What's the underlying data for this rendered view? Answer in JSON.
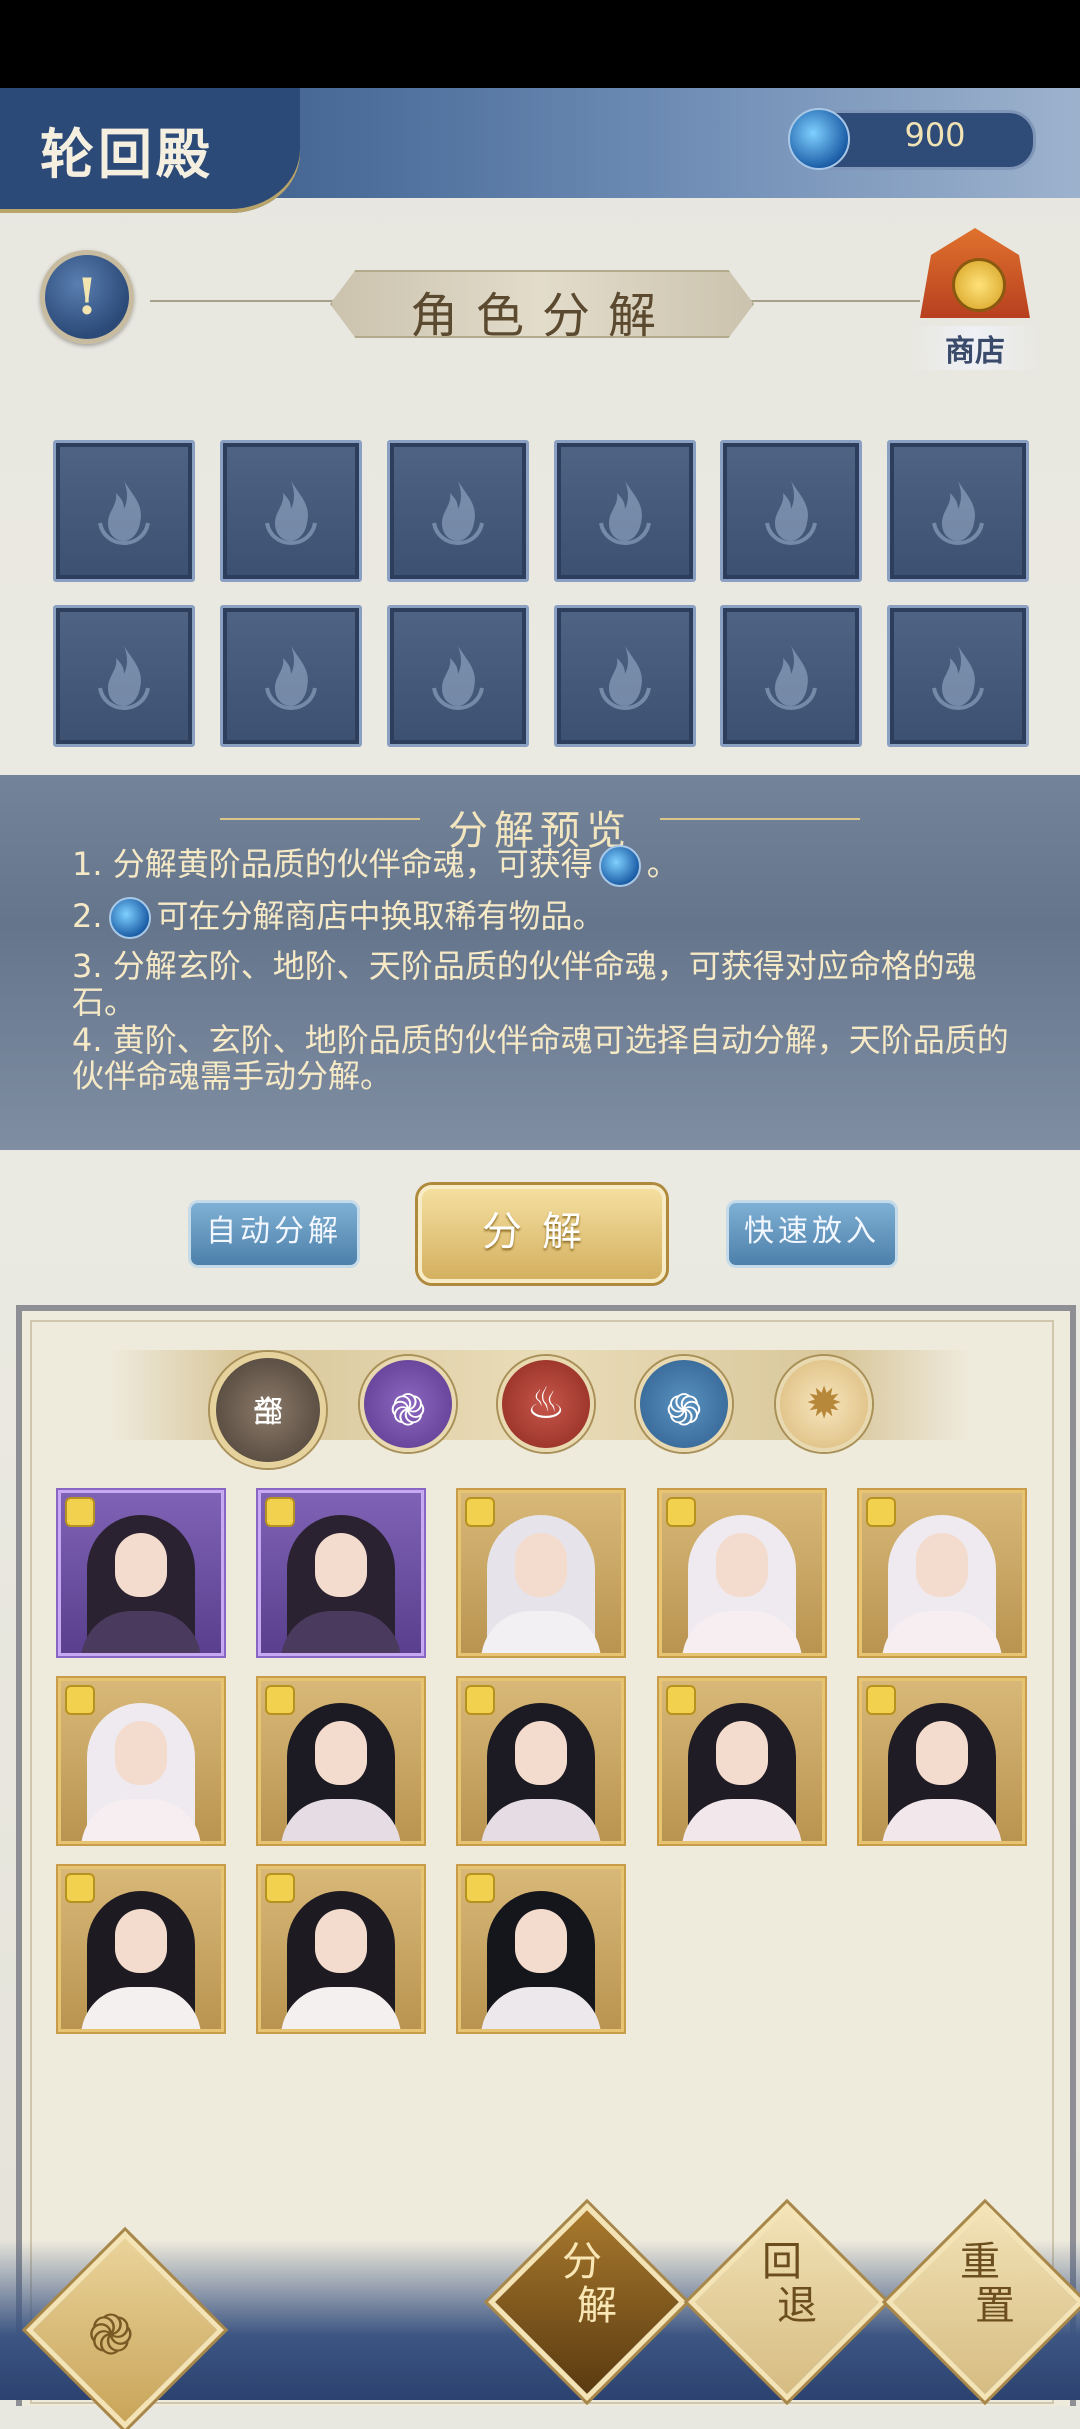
{
  "header": {
    "title": "轮回殿",
    "currency_value": "900"
  },
  "section_title": "角色分解",
  "shop_label": "商店",
  "slots_count": 12,
  "preview": {
    "title": "分解预览",
    "line1_a": "1. 分解黄阶品质的伙伴命魂，可获得",
    "line1_b": "。",
    "line2_a": "2.",
    "line2_b": "可在分解商店中换取稀有物品。",
    "line3": "3. 分解玄阶、地阶、天阶品质的伙伴命魂，可获得对应命格的魂石。",
    "line4": "4. 黄阶、玄阶、地阶品质的伙伴命魂可选择自动分解，天阶品质的伙伴命魂需手动分解。"
  },
  "buttons": {
    "auto": "自动分解",
    "decompose": "分解",
    "quick": "快速放入"
  },
  "filters": {
    "all_line1": "全",
    "all_line2": "部"
  },
  "bottom": {
    "decompose_top": "分",
    "decompose_bottom": "解",
    "back_top": "回",
    "back_bottom": "退",
    "reset_top": "重",
    "reset_bottom": "置"
  },
  "colors": {
    "header_blue": "#2c4a78",
    "gold": "#d4b060",
    "slot_blue": "#4f6484",
    "purple_card": "#7f62b5"
  }
}
